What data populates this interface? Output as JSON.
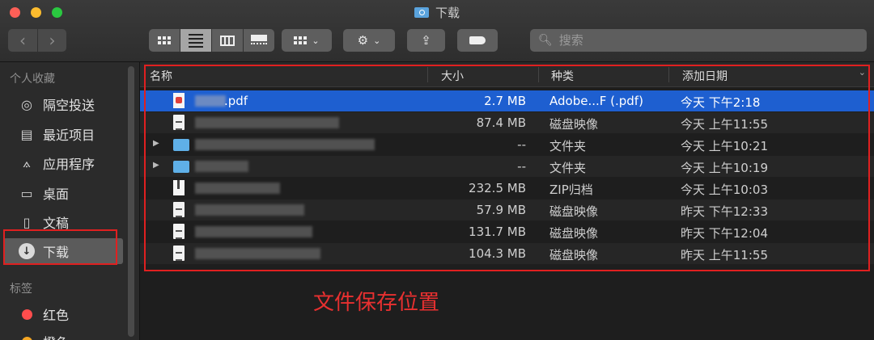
{
  "window": {
    "title": "下载"
  },
  "toolbar": {
    "back_label": "‹",
    "forward_label": "›",
    "search": {
      "placeholder": "搜索",
      "value": ""
    }
  },
  "sidebar": {
    "favorites_heading": "个人收藏",
    "items": [
      {
        "label": "隔空投送",
        "icon": "airdrop-icon"
      },
      {
        "label": "最近项目",
        "icon": "recents-icon"
      },
      {
        "label": "应用程序",
        "icon": "applications-icon"
      },
      {
        "label": "桌面",
        "icon": "desktop-icon"
      },
      {
        "label": "文稿",
        "icon": "documents-icon"
      },
      {
        "label": "下载",
        "icon": "downloads-icon",
        "selected": true
      }
    ],
    "tags_heading": "标签",
    "tags": [
      {
        "label": "红色",
        "color": "#ff4d4d"
      },
      {
        "label": "橙色",
        "color": "#f5a623"
      }
    ]
  },
  "columns": {
    "name": "名称",
    "size": "大小",
    "kind": "种类",
    "date": "添加日期"
  },
  "files": [
    {
      "name": ".pdf",
      "size": "2.7 MB",
      "kind": "Adobe...F (.pdf)",
      "date": "今天 下午2:18",
      "type": "pdf",
      "selected": true
    },
    {
      "name": "",
      "size": "87.4 MB",
      "kind": "磁盘映像",
      "date": "今天 上午11:55",
      "type": "doc"
    },
    {
      "name": "",
      "size": "--",
      "kind": "文件夹",
      "date": "今天 上午10:21",
      "type": "folder"
    },
    {
      "name": "",
      "size": "--",
      "kind": "文件夹",
      "date": "今天 上午10:19",
      "type": "folder"
    },
    {
      "name": "",
      "size": "232.5 MB",
      "kind": "ZIP归档",
      "date": "今天 上午10:03",
      "type": "zip"
    },
    {
      "name": "",
      "size": "57.9 MB",
      "kind": "磁盘映像",
      "date": "昨天 下午12:33",
      "type": "doc"
    },
    {
      "name": "",
      "size": "131.7 MB",
      "kind": "磁盘映像",
      "date": "昨天 下午12:04",
      "type": "doc"
    },
    {
      "name": "",
      "size": "104.3 MB",
      "kind": "磁盘映像",
      "date": "昨天 上午11:55",
      "type": "doc"
    }
  ],
  "annotation": {
    "text": "文件保存位置",
    "color": "#e83030"
  },
  "colors": {
    "accent": "#1e5fd0",
    "highlight": "#e02020"
  }
}
